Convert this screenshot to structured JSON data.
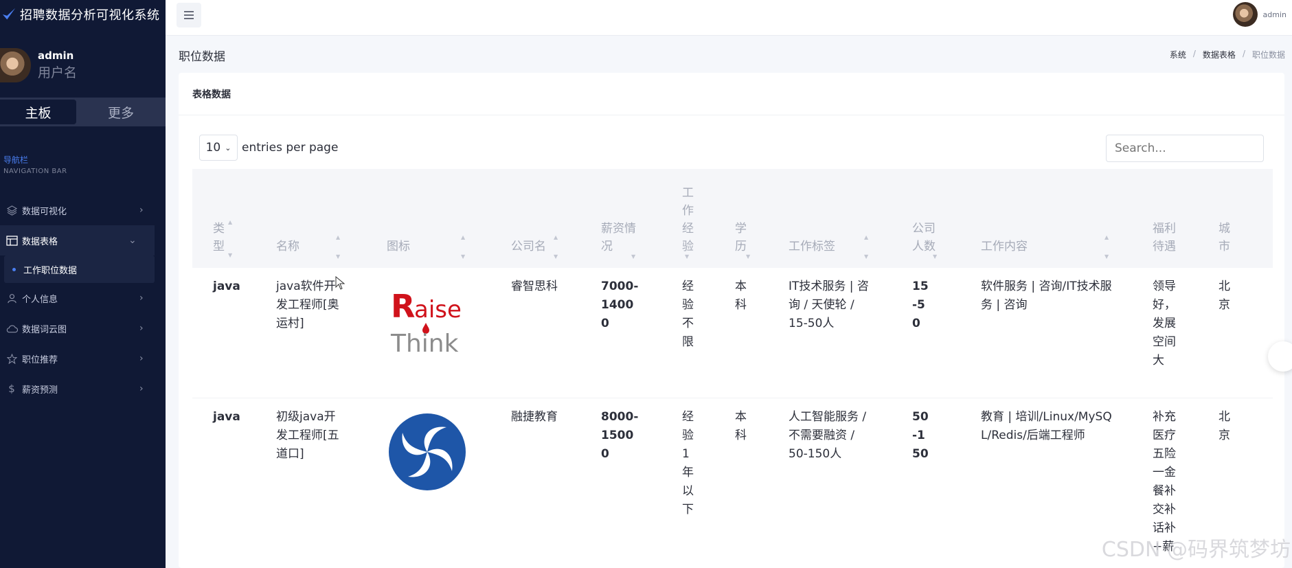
{
  "brand": {
    "title": "招聘数据分析可视化系统"
  },
  "user": {
    "name": "admin",
    "role": "用户名"
  },
  "sidebar_tabs": {
    "main": "主板",
    "more": "更多"
  },
  "nav": {
    "title_cn": "导航栏",
    "title_en": "NAVIGATION BAR",
    "items": [
      {
        "label": "数据可视化",
        "icon": "layers-icon"
      },
      {
        "label": "数据表格",
        "icon": "table-icon",
        "open": true
      },
      {
        "label": "工作职位数据",
        "sub": true
      },
      {
        "label": "个人信息",
        "icon": "user-icon"
      },
      {
        "label": "数据词云图",
        "icon": "cloud-icon"
      },
      {
        "label": "职位推荐",
        "icon": "star-icon"
      },
      {
        "label": "薪资预测",
        "icon": "dollar-icon"
      }
    ]
  },
  "topbar": {
    "user_name": "admin"
  },
  "page": {
    "title": "职位数据",
    "breadcrumb": [
      "系统",
      "数据表格",
      "职位数据"
    ]
  },
  "card": {
    "title": "表格数据"
  },
  "datatable": {
    "entries_value": "10",
    "entries_label": "entries per page",
    "search_placeholder": "Search..."
  },
  "table": {
    "columns": [
      "类型",
      "名称",
      "图标",
      "公司名",
      "薪资情况",
      "工作经验",
      "学历",
      "工作标签",
      "公司人数",
      "工作内容",
      "福利待遇",
      "城市"
    ],
    "rows": [
      {
        "type": "java",
        "name": "java软件开发工程师[奥运村]",
        "logo": "Raise Think",
        "company": "睿智思科",
        "salary": "7000-14000",
        "experience": "经验不限",
        "education": "本科",
        "tags": "IT技术服务 | 咨询 / 天使轮 / 15-50人",
        "size": "15-50",
        "content": "软件服务 | 咨询/IT技术服务 | 咨询",
        "welfare": "领导好，发展空间大",
        "city": "北京"
      },
      {
        "type": "java",
        "name": "初级java开发工程师[五道口]",
        "logo": "融捷教育 logo",
        "company": "融捷教育",
        "salary": "8000-15000",
        "experience": "经验1年以下",
        "education": "本科",
        "tags": "人工智能服务 / 不需要融资 / 50-150人",
        "size": "50-150",
        "content": "教育 | 培训/Linux/MySQL/Redis/后端工程师",
        "welfare": "补充医疗五险一金餐补交补话补+薪",
        "city": "北京"
      }
    ]
  },
  "watermark": "CSDN @码界筑梦坊",
  "colors": {
    "sidebar": "#101935",
    "accent": "#4a7ef0",
    "logo_red": "#d0121b",
    "logo_blue": "#1e56a8"
  }
}
